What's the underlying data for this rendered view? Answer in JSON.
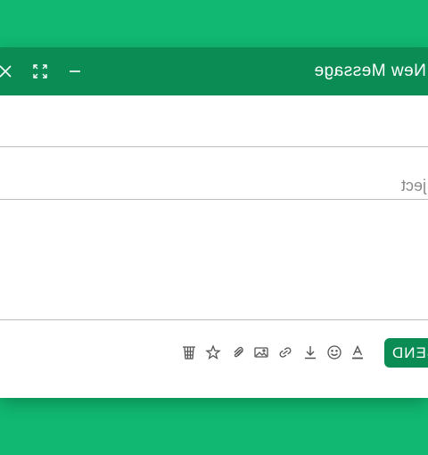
{
  "window": {
    "title": "New Message",
    "controls": [
      "close-icon",
      "expand-icon",
      "minimize-icon"
    ]
  },
  "fields": {
    "recipients_value": "",
    "subject_placeholder": "Subject",
    "subject_visible_text": "ject",
    "body_value": ""
  },
  "toolbar": {
    "send_label": "SEND",
    "send_visible_text": "SEND",
    "icons": [
      "table-icon",
      "star-icon",
      "attachment-icon",
      "image-icon",
      "link-icon",
      "download-icon",
      "emoji-icon",
      "text-format-icon"
    ]
  },
  "colors": {
    "background": "#10b871",
    "titlebar": "#0b8c55",
    "send_button": "#0b8c55"
  }
}
